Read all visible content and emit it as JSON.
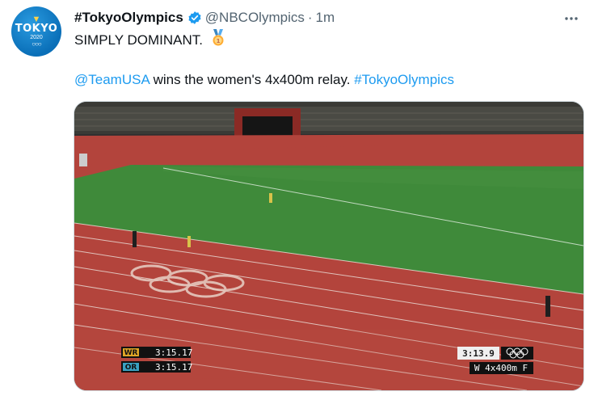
{
  "tweet": {
    "display_name": "#TokyoOlympics",
    "handle": "@NBCOlympics",
    "separator": "·",
    "time": "1m",
    "line1": "SIMPLY DOMINANT.",
    "line2_mention": "@TeamUSA",
    "line2_text": " wins the women's 4x400m relay. ",
    "line2_hashtag": "#TokyoOlympics"
  },
  "avatar": {
    "word": "TOKYO",
    "year": "2020"
  },
  "video_overlay": {
    "wr_label": "WR",
    "wr_time": "3:15.17",
    "or_label": "OR",
    "or_time": "3:15.17",
    "race_time": "3:13.9",
    "event": "W 4x400m F"
  },
  "icons": {
    "verified": "verified-badge-icon",
    "medal": "gold-medal-emoji-icon",
    "more": "more-options-icon"
  },
  "colors": {
    "link": "#1d9bf0",
    "secondary_text": "#536471",
    "track": "#b3443c",
    "field": "#3f8a3a"
  }
}
